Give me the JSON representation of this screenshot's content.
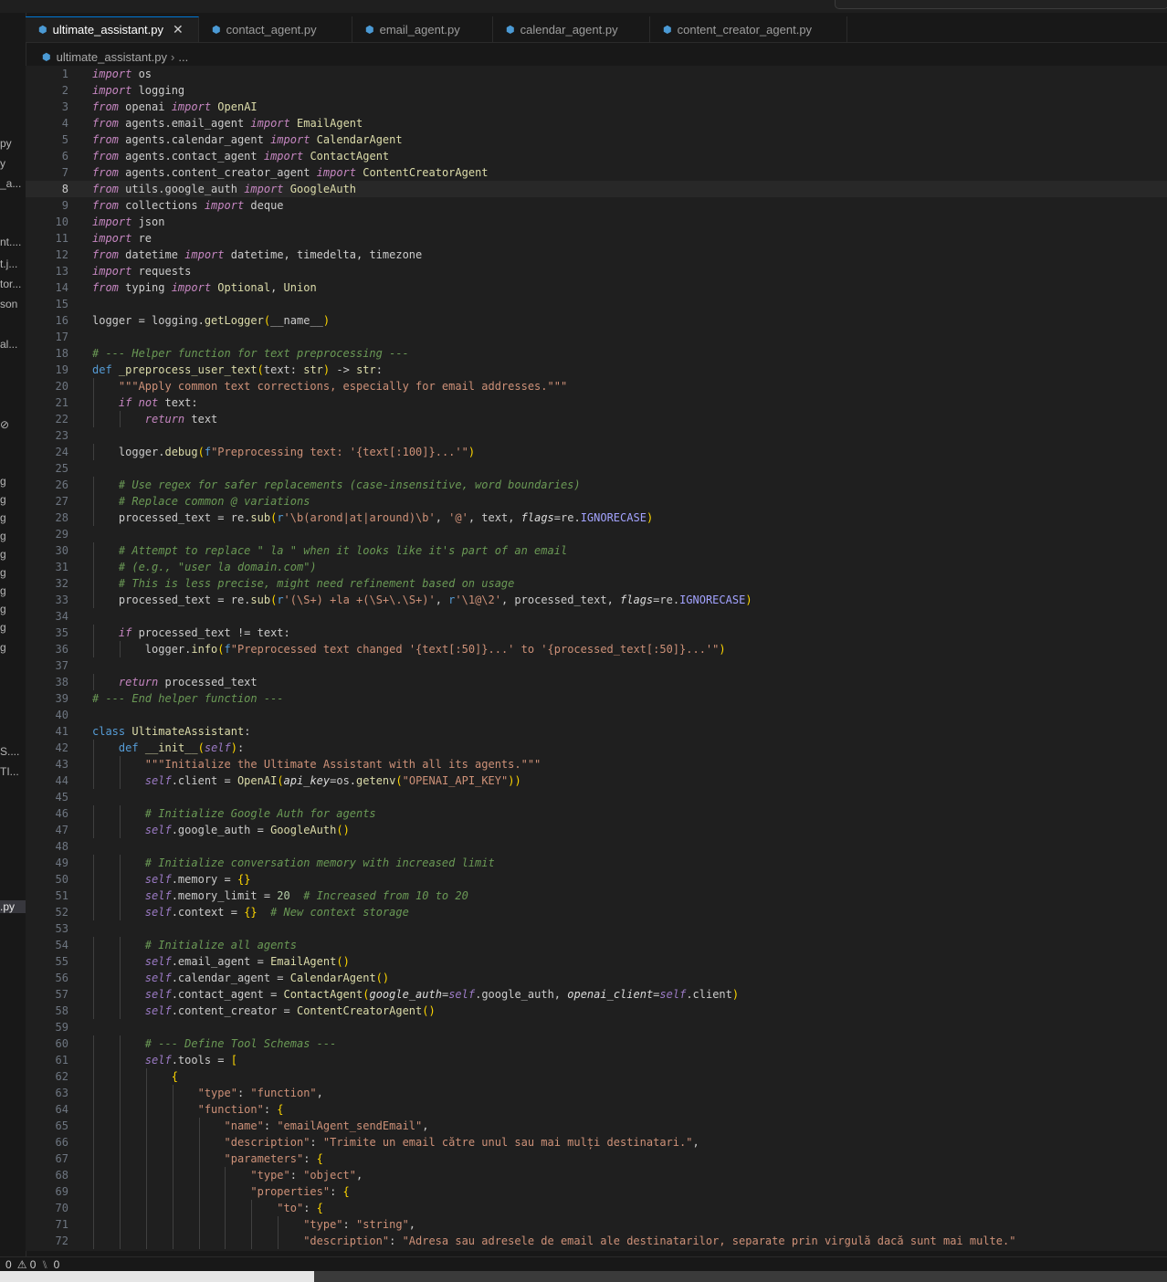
{
  "tabs": [
    {
      "label": "ultimate_assistant.py",
      "active": true
    },
    {
      "label": "contact_agent.py",
      "active": false
    },
    {
      "label": "email_agent.py",
      "active": false
    },
    {
      "label": "calendar_agent.py",
      "active": false
    },
    {
      "label": "content_creator_agent.py",
      "active": false
    }
  ],
  "breadcrumb": {
    "file": "ultimate_assistant.py",
    "rest": "..."
  },
  "sidebar_fragments": [
    "py",
    "y",
    "_a...",
    "nt....",
    "t.j...",
    "tor...",
    "son",
    "al...",
    "⊘",
    "g",
    "g",
    "g",
    "g",
    "g",
    "g",
    "g",
    "g",
    "g",
    "g",
    "S....",
    "TI...",
    ".py"
  ],
  "status": {
    "problems_warnings": "⚠ 0",
    "ports": "0",
    "errors": "0"
  },
  "current_line": 8,
  "lines": [
    "import os",
    "import logging",
    "from openai import OpenAI",
    "from agents.email_agent import EmailAgent",
    "from agents.calendar_agent import CalendarAgent",
    "from agents.contact_agent import ContactAgent",
    "from agents.content_creator_agent import ContentCreatorAgent",
    "from utils.google_auth import GoogleAuth",
    "from collections import deque",
    "import json",
    "import re",
    "from datetime import datetime, timedelta, timezone",
    "import requests",
    "from typing import Optional, Union",
    "",
    "logger = logging.getLogger(__name__)",
    "",
    "# --- Helper function for text preprocessing ---",
    "def _preprocess_user_text(text: str) -> str:",
    "    \"\"\"Apply common text corrections, especially for email addresses.\"\"\"",
    "    if not text:",
    "        return text",
    "",
    "    logger.debug(f\"Preprocessing text: '{text[:100]}...'\")",
    "",
    "    # Use regex for safer replacements (case-insensitive, word boundaries)",
    "    # Replace common @ variations",
    "    processed_text = re.sub(r'\\b(arond|at|around)\\b', '@', text, flags=re.IGNORECASE)",
    "",
    "    # Attempt to replace \" la \" when it looks like it's part of an email",
    "    # (e.g., \"user la domain.com\")",
    "    # This is less precise, might need refinement based on usage",
    "    processed_text = re.sub(r'(\\S+) +la +(\\S+\\.\\S+)', r'\\1@\\2', processed_text, flags=re.IGNORECASE)",
    "",
    "    if processed_text != text:",
    "        logger.info(f\"Preprocessed text changed '{text[:50]}...' to '{processed_text[:50]}...'\")",
    "",
    "    return processed_text",
    "# --- End helper function ---",
    "",
    "class UltimateAssistant:",
    "    def __init__(self):",
    "        \"\"\"Initialize the Ultimate Assistant with all its agents.\"\"\"",
    "        self.client = OpenAI(api_key=os.getenv(\"OPENAI_API_KEY\"))",
    "",
    "        # Initialize Google Auth for agents",
    "        self.google_auth = GoogleAuth()",
    "",
    "        # Initialize conversation memory with increased limit",
    "        self.memory = {}",
    "        self.memory_limit = 20  # Increased from 10 to 20",
    "        self.context = {}  # New context storage",
    "",
    "        # Initialize all agents",
    "        self.email_agent = EmailAgent()",
    "        self.calendar_agent = CalendarAgent()",
    "        self.contact_agent = ContactAgent(google_auth=self.google_auth, openai_client=self.client)",
    "        self.content_creator = ContentCreatorAgent()",
    "",
    "        # --- Define Tool Schemas ---",
    "        self.tools = [",
    "            {",
    "                \"type\": \"function\",",
    "                \"function\": {",
    "                    \"name\": \"emailAgent_sendEmail\",",
    "                    \"description\": \"Trimite un email către unul sau mai mulți destinatari.\",",
    "                    \"parameters\": {",
    "                        \"type\": \"object\",",
    "                        \"properties\": {",
    "                            \"to\": {",
    "                                \"type\": \"string\",",
    "                                \"description\": \"Adresa sau adresele de email ale destinatarilor, separate prin virgulă dacă sunt mai multe.\""
  ]
}
